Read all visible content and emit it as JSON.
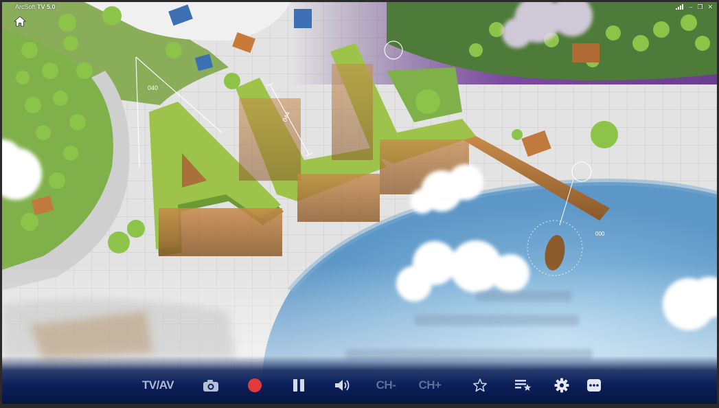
{
  "window": {
    "app_name": "ArcSoft",
    "app_version": "TV 5.0",
    "controls": [
      "minimize-icon",
      "restore-icon",
      "close-icon"
    ]
  },
  "video": {
    "overlay_text": "ALL",
    "measure_labels": [
      "040",
      "044",
      "000"
    ]
  },
  "toolbar": {
    "tvav_label": "TV/AV",
    "ch_minus_label": "CH-",
    "ch_plus_label": "CH+",
    "icons": [
      "camera-icon",
      "record-icon",
      "pause-icon",
      "volume-icon",
      "star-icon",
      "playlist-icon",
      "settings-icon",
      "more-icon"
    ]
  },
  "colors": {
    "toolbar_bg": "#0b1f5c",
    "toolbar_text": "#aeb9cf",
    "toolbar_text_disabled": "#5f6f95",
    "record_red": "#e23b3b"
  }
}
